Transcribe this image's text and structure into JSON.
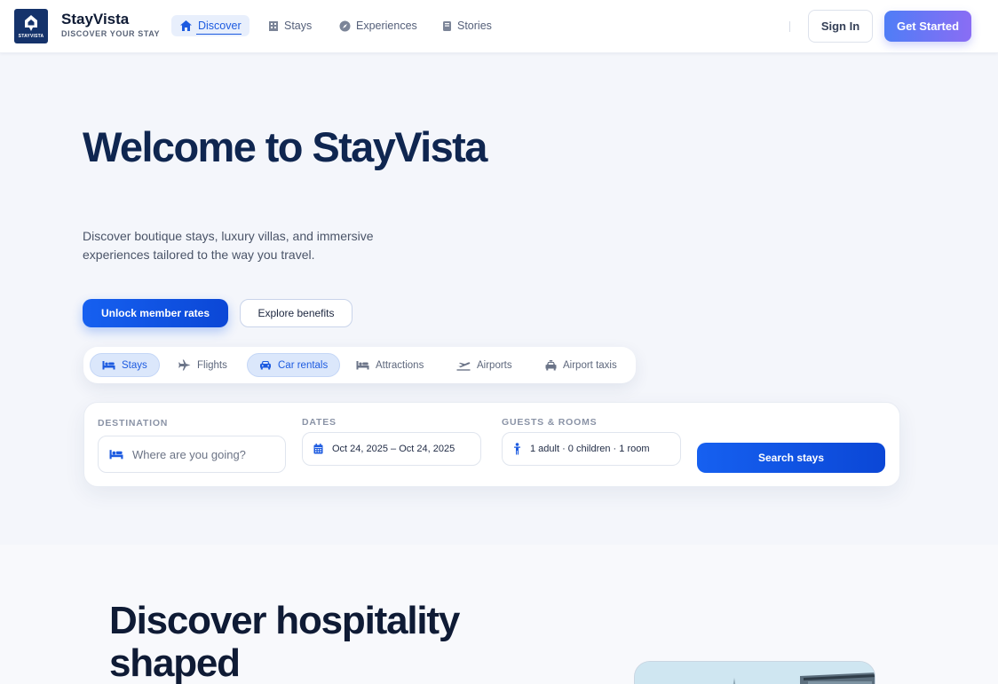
{
  "brand": {
    "name": "StayVista",
    "tagline": "DISCOVER YOUR STAY",
    "logo_text": "STAYVISTA",
    "color": "#15336b"
  },
  "nav": {
    "items": [
      {
        "label": "Discover",
        "icon": "home-icon",
        "active": true
      },
      {
        "label": "Stays",
        "icon": "building-icon",
        "active": false
      },
      {
        "label": "Experiences",
        "icon": "compass-icon",
        "active": false
      },
      {
        "label": "Stories",
        "icon": "book-icon",
        "active": false
      }
    ],
    "sign_in": "Sign In",
    "get_started": "Get Started"
  },
  "hero": {
    "title": "Welcome to StayVista",
    "subtitle": "Discover boutique stays, luxury villas, and immersive experiences tailored to the way you travel.",
    "primary_button": "Unlock member rates",
    "secondary_button": "Explore benefits"
  },
  "categories": [
    {
      "label": "Stays",
      "icon": "bed-icon",
      "active": true
    },
    {
      "label": "Flights",
      "icon": "plane-icon",
      "active": false
    },
    {
      "label": "Car rentals",
      "icon": "car-icon",
      "active": true
    },
    {
      "label": "Attractions",
      "icon": "bed-icon",
      "active": false
    },
    {
      "label": "Airports",
      "icon": "plane-departure-icon",
      "active": false
    },
    {
      "label": "Airport taxis",
      "icon": "taxi-icon",
      "active": false
    }
  ],
  "search": {
    "destination_label": "DESTINATION",
    "destination_placeholder": "Where are you going?",
    "dates_label": "DATES",
    "dates_value": "Oct 24, 2025 – Oct 24, 2025",
    "guests_label": "GUESTS & ROOMS",
    "guests_value": "1 adult · 0 children · 1 room",
    "button": "Search stays"
  },
  "section": {
    "title": "Discover hospitality shaped"
  },
  "colors": {
    "accent": "#1d5be0",
    "heading": "#0f2650",
    "background": "#f4f6fb"
  }
}
